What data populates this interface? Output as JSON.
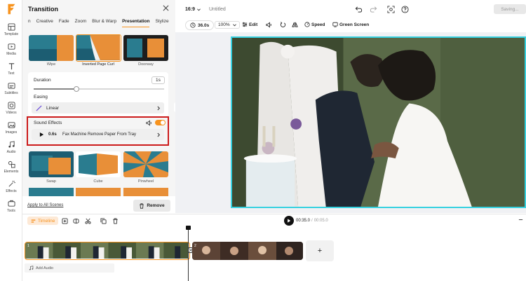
{
  "app": {
    "logo_letter": "F",
    "brand_color": "#f7931e"
  },
  "rail": [
    {
      "label": "Template",
      "icon": "template-icon"
    },
    {
      "label": "Media",
      "icon": "media-icon"
    },
    {
      "label": "Text",
      "icon": "text-icon"
    },
    {
      "label": "Subtitles",
      "icon": "subtitles-icon"
    },
    {
      "label": "Videos",
      "icon": "videos-icon"
    },
    {
      "label": "Images",
      "icon": "images-icon"
    },
    {
      "label": "Audio",
      "icon": "audio-icon"
    },
    {
      "label": "Elements",
      "icon": "elements-icon"
    },
    {
      "label": "Effects",
      "icon": "effects-icon"
    },
    {
      "label": "Tools",
      "icon": "tools-icon"
    }
  ],
  "panel": {
    "title": "Transition",
    "tabs": [
      "n",
      "Creative",
      "Fade",
      "Zoom",
      "Blur & Warp",
      "Presentation",
      "Stylize"
    ],
    "active_tab": "Presentation",
    "top_thumbs": [
      "Wipe",
      "Inverted Page Curl",
      "Doorway"
    ],
    "bottom_thumbs": [
      "Swap",
      "Cube",
      "Pinwheel"
    ],
    "duration_label": "Duration",
    "duration_value": "1s",
    "duration_fraction": 0.33,
    "easing_label": "Easing",
    "easing_value": "Linear",
    "sound_label": "Sound Effects",
    "sound_duration": "0.6s",
    "sound_name": "Fax Machine Remove Paper From Tray",
    "apply_all": "Apply to All Scenes",
    "remove": "Remove"
  },
  "topbar": {
    "aspect": "16:9",
    "project_title": "Untitled",
    "saving": "Saving..."
  },
  "toolbar": {
    "duration": "36.0s",
    "zoom": "100%",
    "edit": "Edit",
    "speed": "Speed",
    "green_screen": "Green Screen"
  },
  "timeline": {
    "label": "Timeline",
    "current_time": "00:35.0",
    "total_time": "00:05.0",
    "clip1_badge": "1",
    "clip2_badge": "2",
    "add_audio": "Add Audio",
    "add_scene": "+"
  }
}
